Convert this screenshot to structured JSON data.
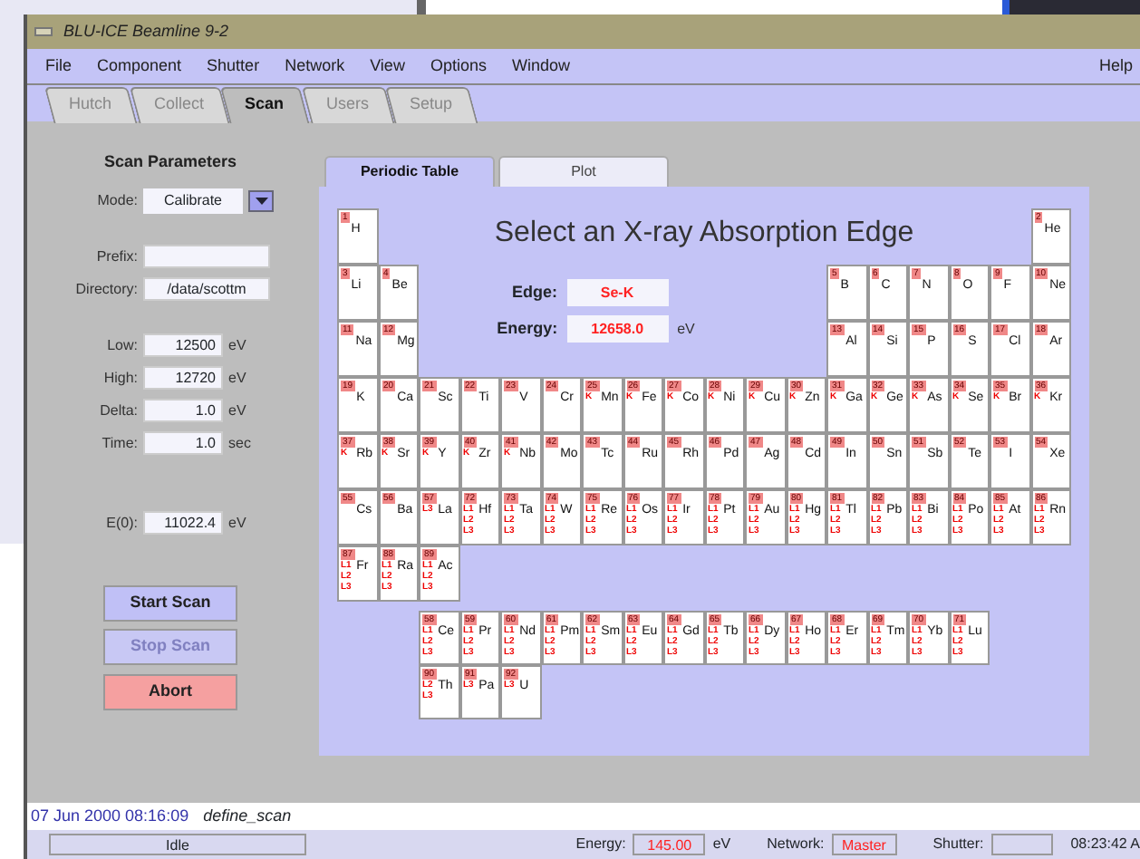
{
  "window": {
    "title": "BLU-ICE   Beamline 9-2"
  },
  "menu": [
    "File",
    "Component",
    "Shutter",
    "Network",
    "View",
    "Options",
    "Window"
  ],
  "help_menu": "Help",
  "tabs": [
    {
      "label": "Hutch",
      "selected": false
    },
    {
      "label": "Collect",
      "selected": false
    },
    {
      "label": "Scan",
      "selected": true
    },
    {
      "label": "Users",
      "selected": false
    },
    {
      "label": "Setup",
      "selected": false
    }
  ],
  "scan_parameters": {
    "title": "Scan Parameters",
    "mode": {
      "label": "Mode:",
      "value": "Calibrate"
    },
    "fields": [
      {
        "label": "Prefix:"
      },
      {
        "label": "Directory:",
        "value": "/data/scottm"
      },
      {
        "label": "Low:",
        "value": "12500",
        "unit": "eV"
      },
      {
        "label": "High:",
        "value": "12720",
        "unit": "eV"
      },
      {
        "label": "Delta:",
        "value": "1.0",
        "unit": "eV"
      },
      {
        "label": "Time:",
        "value": "1.0",
        "unit": "sec"
      },
      {
        "label": "E(0):",
        "value": "11022.4",
        "unit": "eV"
      }
    ],
    "buttons": [
      {
        "label": "Start Scan",
        "kind": "normal",
        "disabled": false
      },
      {
        "label": "Stop Scan",
        "kind": "normal",
        "disabled": true
      },
      {
        "label": "Abort",
        "kind": "danger",
        "disabled": false
      }
    ]
  },
  "view_tabs": [
    {
      "label": "Periodic Table",
      "selected": true
    },
    {
      "label": "Plot",
      "selected": false
    }
  ],
  "periodic_table": {
    "title": "Select an X-ray Absorption Edge",
    "edge": {
      "label": "Edge:",
      "value": "Se-K"
    },
    "energy": {
      "label": "Energy:",
      "value": "12658.0",
      "unit": "eV"
    },
    "rows": [
      [
        {
          "number": "1",
          "symbol": "H"
        },
        "",
        "",
        "",
        "",
        "",
        "",
        "",
        "",
        "",
        "",
        "",
        "",
        "",
        "",
        "",
        "",
        {
          "number": "2",
          "symbol": "He"
        }
      ],
      [
        {
          "number": "3",
          "symbol": "Li"
        },
        {
          "number": "4",
          "symbol": "Be"
        },
        "",
        "",
        "",
        "",
        "",
        "",
        "",
        "",
        "",
        "",
        {
          "number": "5",
          "symbol": "B"
        },
        {
          "number": "6",
          "symbol": "C"
        },
        {
          "number": "7",
          "symbol": "N"
        },
        {
          "number": "8",
          "symbol": "O"
        },
        {
          "number": "9",
          "symbol": "F"
        },
        {
          "number": "10",
          "symbol": "Ne"
        }
      ],
      [
        {
          "number": "11",
          "symbol": "Na"
        },
        {
          "number": "12",
          "symbol": "Mg"
        },
        "",
        "",
        "",
        "",
        "",
        "",
        "",
        "",
        "",
        "",
        {
          "number": "13",
          "symbol": "Al"
        },
        {
          "number": "14",
          "symbol": "Si"
        },
        {
          "number": "15",
          "symbol": "P"
        },
        {
          "number": "16",
          "symbol": "S"
        },
        {
          "number": "17",
          "symbol": "Cl"
        },
        {
          "number": "18",
          "symbol": "Ar"
        }
      ],
      [
        {
          "number": "19",
          "symbol": "K"
        },
        {
          "number": "20",
          "symbol": "Ca"
        },
        {
          "number": "21",
          "symbol": "Sc"
        },
        {
          "number": "22",
          "symbol": "Ti"
        },
        {
          "number": "23",
          "symbol": "V"
        },
        {
          "number": "24",
          "symbol": "Cr"
        },
        {
          "number": "25",
          "symbol": "Mn",
          "edges": [
            "K"
          ]
        },
        {
          "number": "26",
          "symbol": "Fe",
          "edges": [
            "K"
          ]
        },
        {
          "number": "27",
          "symbol": "Co",
          "edges": [
            "K"
          ]
        },
        {
          "number": "28",
          "symbol": "Ni",
          "edges": [
            "K"
          ]
        },
        {
          "number": "29",
          "symbol": "Cu",
          "edges": [
            "K"
          ]
        },
        {
          "number": "30",
          "symbol": "Zn",
          "edges": [
            "K"
          ]
        },
        {
          "number": "31",
          "symbol": "Ga",
          "edges": [
            "K"
          ]
        },
        {
          "number": "32",
          "symbol": "Ge",
          "edges": [
            "K"
          ]
        },
        {
          "number": "33",
          "symbol": "As",
          "edges": [
            "K"
          ]
        },
        {
          "number": "34",
          "symbol": "Se",
          "edges": [
            "K"
          ]
        },
        {
          "number": "35",
          "symbol": "Br",
          "edges": [
            "K"
          ]
        },
        {
          "number": "36",
          "symbol": "Kr",
          "edges": [
            "K"
          ]
        }
      ],
      [
        {
          "number": "37",
          "symbol": "Rb",
          "edges": [
            "K"
          ]
        },
        {
          "number": "38",
          "symbol": "Sr",
          "edges": [
            "K"
          ]
        },
        {
          "number": "39",
          "symbol": "Y",
          "edges": [
            "K"
          ]
        },
        {
          "number": "40",
          "symbol": "Zr",
          "edges": [
            "K"
          ]
        },
        {
          "number": "41",
          "symbol": "Nb",
          "edges": [
            "K"
          ]
        },
        {
          "number": "42",
          "symbol": "Mo"
        },
        {
          "number": "43",
          "symbol": "Tc"
        },
        {
          "number": "44",
          "symbol": "Ru"
        },
        {
          "number": "45",
          "symbol": "Rh"
        },
        {
          "number": "46",
          "symbol": "Pd"
        },
        {
          "number": "47",
          "symbol": "Ag"
        },
        {
          "number": "48",
          "symbol": "Cd"
        },
        {
          "number": "49",
          "symbol": "In"
        },
        {
          "number": "50",
          "symbol": "Sn"
        },
        {
          "number": "51",
          "symbol": "Sb"
        },
        {
          "number": "52",
          "symbol": "Te"
        },
        {
          "number": "53",
          "symbol": "I"
        },
        {
          "number": "54",
          "symbol": "Xe"
        }
      ],
      [
        {
          "number": "55",
          "symbol": "Cs"
        },
        {
          "number": "56",
          "symbol": "Ba"
        },
        {
          "number": "57",
          "symbol": "La",
          "edges": [
            "L3"
          ]
        },
        {
          "number": "72",
          "symbol": "Hf",
          "edges": [
            "L1",
            "L2",
            "L3"
          ]
        },
        {
          "number": "73",
          "symbol": "Ta",
          "edges": [
            "L1",
            "L2",
            "L3"
          ]
        },
        {
          "number": "74",
          "symbol": "W",
          "edges": [
            "L1",
            "L2",
            "L3"
          ]
        },
        {
          "number": "75",
          "symbol": "Re",
          "edges": [
            "L1",
            "L2",
            "L3"
          ]
        },
        {
          "number": "76",
          "symbol": "Os",
          "edges": [
            "L1",
            "L2",
            "L3"
          ]
        },
        {
          "number": "77",
          "symbol": "Ir",
          "edges": [
            "L1",
            "L2",
            "L3"
          ]
        },
        {
          "number": "78",
          "symbol": "Pt",
          "edges": [
            "L1",
            "L2",
            "L3"
          ]
        },
        {
          "number": "79",
          "symbol": "Au",
          "edges": [
            "L1",
            "L2",
            "L3"
          ]
        },
        {
          "number": "80",
          "symbol": "Hg",
          "edges": [
            "L1",
            "L2",
            "L3"
          ]
        },
        {
          "number": "81",
          "symbol": "Tl",
          "edges": [
            "L1",
            "L2",
            "L3"
          ]
        },
        {
          "number": "82",
          "symbol": "Pb",
          "edges": [
            "L1",
            "L2",
            "L3"
          ]
        },
        {
          "number": "83",
          "symbol": "Bi",
          "edges": [
            "L1",
            "L2",
            "L3"
          ]
        },
        {
          "number": "84",
          "symbol": "Po",
          "edges": [
            "L1",
            "L2",
            "L3"
          ]
        },
        {
          "number": "85",
          "symbol": "At",
          "edges": [
            "L1",
            "L2",
            "L3"
          ]
        },
        {
          "number": "86",
          "symbol": "Rn",
          "edges": [
            "L1",
            "L2",
            "L3"
          ]
        }
      ],
      [
        {
          "number": "87",
          "symbol": "Fr",
          "edges": [
            "L1",
            "L2",
            "L3"
          ]
        },
        {
          "number": "88",
          "symbol": "Ra",
          "edges": [
            "L1",
            "L2",
            "L3"
          ]
        },
        {
          "number": "89",
          "symbol": "Ac",
          "edges": [
            "L1",
            "L2",
            "L3"
          ]
        }
      ]
    ],
    "f_block": [
      [
        {
          "number": "58",
          "symbol": "Ce",
          "edges": [
            "L1",
            "L2",
            "L3"
          ]
        },
        {
          "number": "59",
          "symbol": "Pr",
          "edges": [
            "L1",
            "L2",
            "L3"
          ]
        },
        {
          "number": "60",
          "symbol": "Nd",
          "edges": [
            "L1",
            "L2",
            "L3"
          ]
        },
        {
          "number": "61",
          "symbol": "Pm",
          "edges": [
            "L1",
            "L2",
            "L3"
          ]
        },
        {
          "number": "62",
          "symbol": "Sm",
          "edges": [
            "L1",
            "L2",
            "L3"
          ]
        },
        {
          "number": "63",
          "symbol": "Eu",
          "edges": [
            "L1",
            "L2",
            "L3"
          ]
        },
        {
          "number": "64",
          "symbol": "Gd",
          "edges": [
            "L1",
            "L2",
            "L3"
          ]
        },
        {
          "number": "65",
          "symbol": "Tb",
          "edges": [
            "L1",
            "L2",
            "L3"
          ]
        },
        {
          "number": "66",
          "symbol": "Dy",
          "edges": [
            "L1",
            "L2",
            "L3"
          ]
        },
        {
          "number": "67",
          "symbol": "Ho",
          "edges": [
            "L1",
            "L2",
            "L3"
          ]
        },
        {
          "number": "68",
          "symbol": "Er",
          "edges": [
            "L1",
            "L2",
            "L3"
          ]
        },
        {
          "number": "69",
          "symbol": "Tm",
          "edges": [
            "L1",
            "L2",
            "L3"
          ]
        },
        {
          "number": "70",
          "symbol": "Yb",
          "edges": [
            "L1",
            "L2",
            "L3"
          ]
        },
        {
          "number": "71",
          "symbol": "Lu",
          "edges": [
            "L1",
            "L2",
            "L3"
          ]
        }
      ],
      [
        {
          "number": "90",
          "symbol": "Th",
          "edges": [
            "L2",
            "L3"
          ]
        },
        {
          "number": "91",
          "symbol": "Pa",
          "edges": [
            "L3"
          ]
        },
        {
          "number": "92",
          "symbol": "U",
          "edges": [
            "L3"
          ]
        }
      ]
    ]
  },
  "log": {
    "time": "07 Jun 2000 08:16:09",
    "message": "define_scan"
  },
  "status_bar": {
    "state": "Idle",
    "energy_label": "Energy:",
    "energy": "145.00",
    "energy_unit": "eV",
    "network_label": "Network:",
    "network": "Master",
    "shutter_label": "Shutter:",
    "clock": "08:23:42 A"
  }
}
